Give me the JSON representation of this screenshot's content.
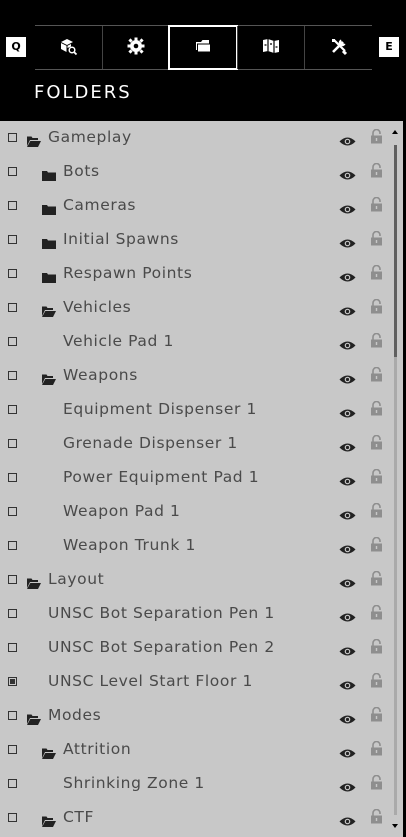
{
  "header": {
    "key_left": "Q",
    "key_right": "E",
    "tabs": [
      {
        "icon": "object-browser-icon",
        "active": false
      },
      {
        "icon": "settings-gear-icon",
        "active": false
      },
      {
        "icon": "folder-icon",
        "active": true
      },
      {
        "icon": "map-icon",
        "active": false
      },
      {
        "icon": "tools-icon",
        "active": false
      }
    ],
    "title": "FOLDERS"
  },
  "rows": [
    {
      "label": "Gameplay",
      "type": "open-folder",
      "indent": 0,
      "checked": false
    },
    {
      "label": "Bots",
      "type": "folder",
      "indent": 1,
      "checked": false
    },
    {
      "label": "Cameras",
      "type": "folder",
      "indent": 1,
      "checked": false
    },
    {
      "label": "Initial Spawns",
      "type": "folder",
      "indent": 1,
      "checked": false
    },
    {
      "label": "Respawn Points",
      "type": "folder",
      "indent": 1,
      "checked": false
    },
    {
      "label": "Vehicles",
      "type": "open-folder",
      "indent": 1,
      "checked": false
    },
    {
      "label": "Vehicle Pad 1",
      "type": "item",
      "indent": 2,
      "checked": false
    },
    {
      "label": "Weapons",
      "type": "open-folder",
      "indent": 1,
      "checked": false
    },
    {
      "label": "Equipment Dispenser 1",
      "type": "item",
      "indent": 2,
      "checked": false
    },
    {
      "label": "Grenade Dispenser 1",
      "type": "item",
      "indent": 2,
      "checked": false
    },
    {
      "label": "Power Equipment Pad 1",
      "type": "item",
      "indent": 2,
      "checked": false
    },
    {
      "label": "Weapon Pad 1",
      "type": "item",
      "indent": 2,
      "checked": false
    },
    {
      "label": "Weapon Trunk 1",
      "type": "item",
      "indent": 2,
      "checked": false
    },
    {
      "label": "Layout",
      "type": "open-folder",
      "indent": 0,
      "checked": false
    },
    {
      "label": "UNSC Bot Separation Pen 1",
      "type": "item",
      "indent": 1,
      "checked": false
    },
    {
      "label": "UNSC Bot Separation Pen 2",
      "type": "item",
      "indent": 1,
      "checked": false
    },
    {
      "label": "UNSC Level Start Floor 1",
      "type": "item",
      "indent": 1,
      "checked": true
    },
    {
      "label": "Modes",
      "type": "open-folder",
      "indent": 0,
      "checked": false
    },
    {
      "label": "Attrition",
      "type": "open-folder",
      "indent": 1,
      "checked": false
    },
    {
      "label": "Shrinking Zone 1",
      "type": "item",
      "indent": 2,
      "checked": false
    },
    {
      "label": "CTF",
      "type": "open-folder",
      "indent": 1,
      "checked": false
    }
  ],
  "row_icons": {
    "visibility": "eye-icon",
    "lock": "lock-icon"
  },
  "colors": {
    "list_bg": "#c8c8c8",
    "text": "#4a4a4a",
    "header_bg": "#000000"
  }
}
